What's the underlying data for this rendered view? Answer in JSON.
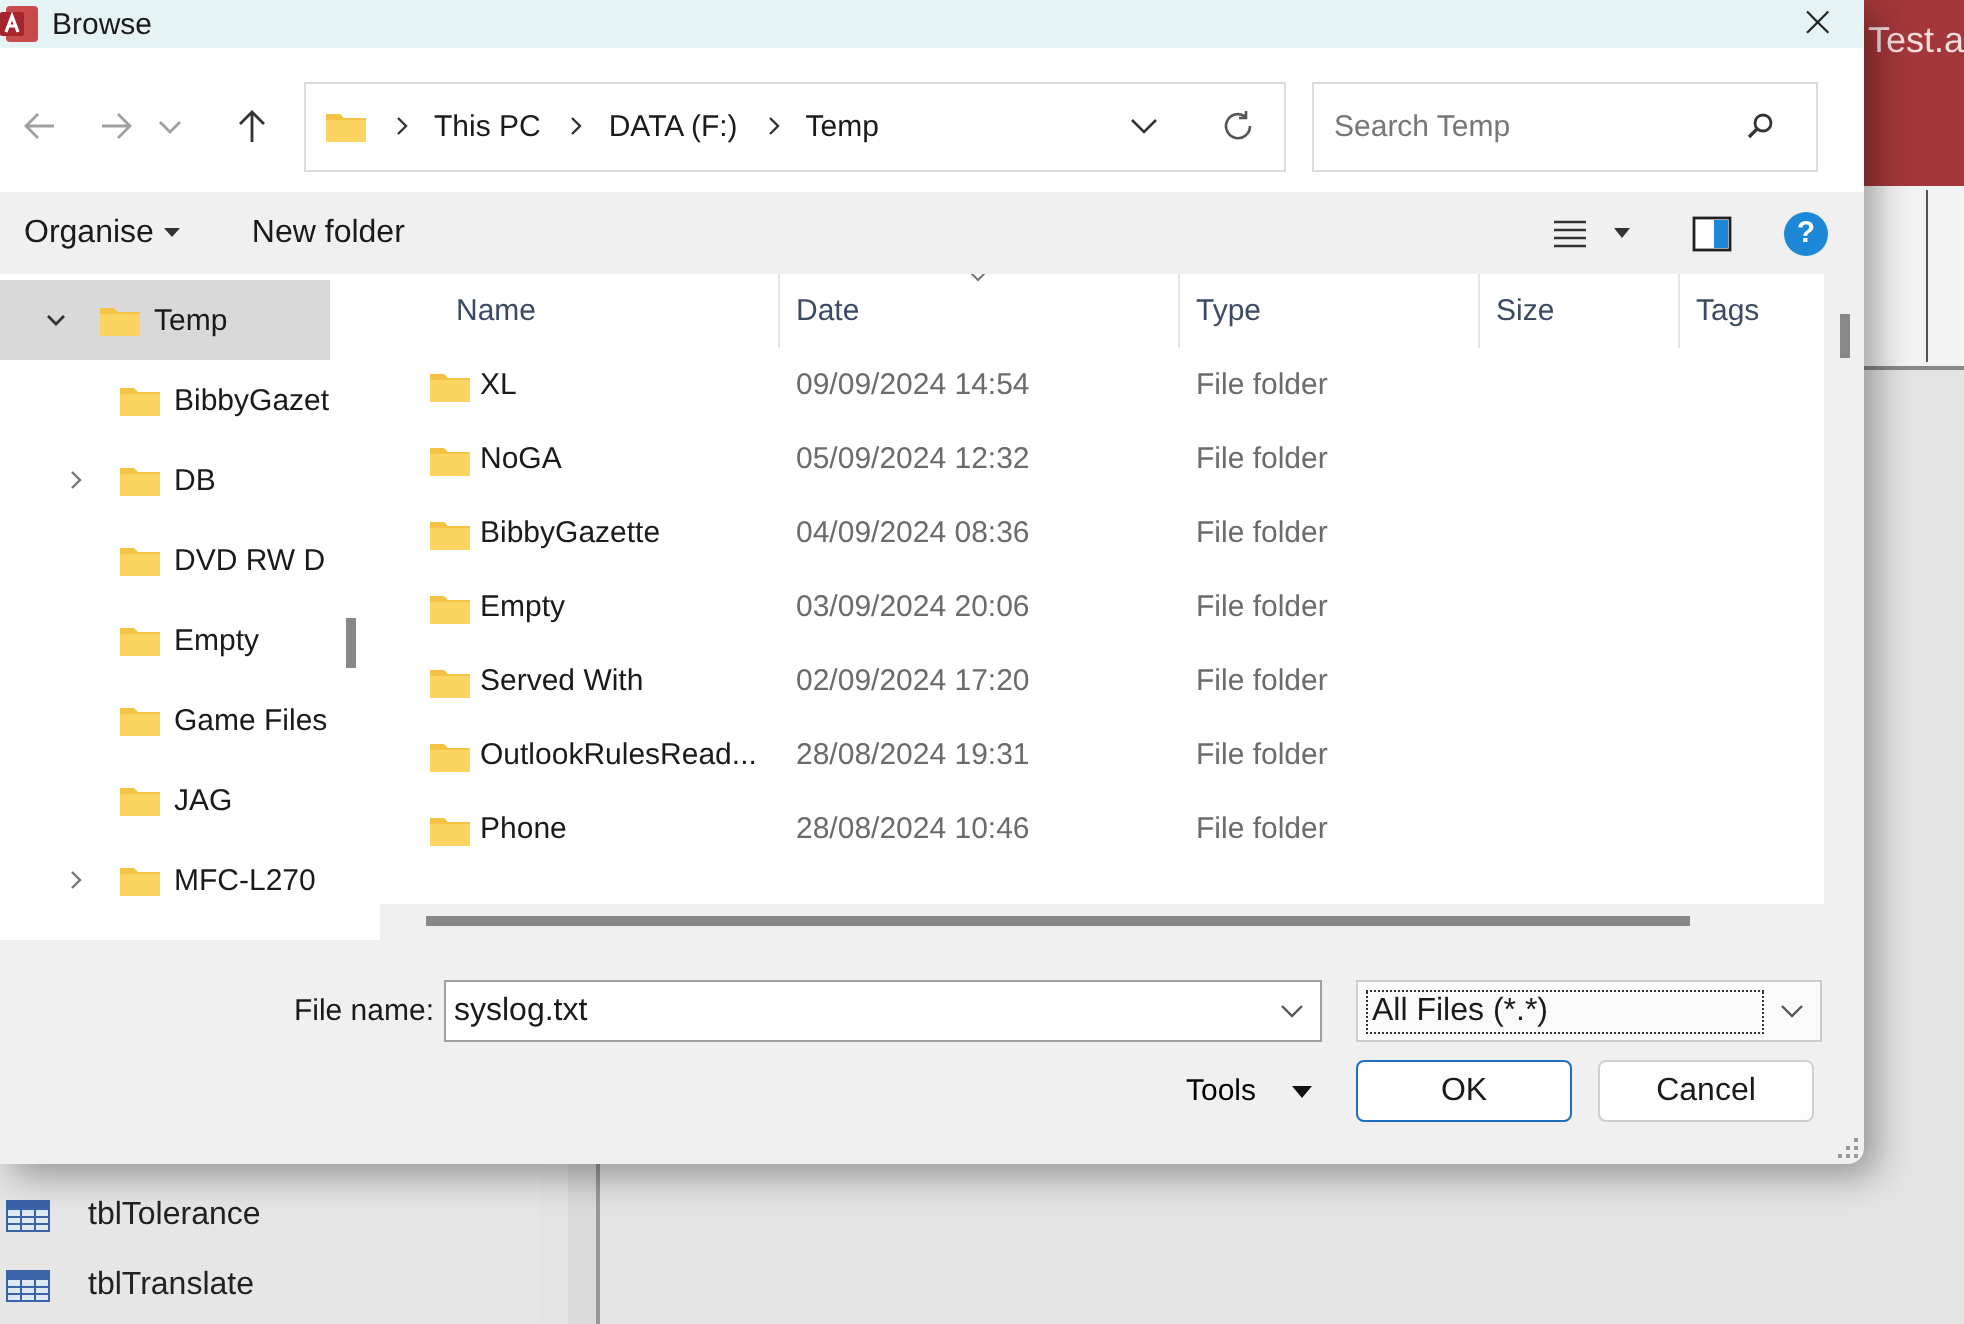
{
  "background_app": {
    "title": "Test.a",
    "tables": [
      {
        "name": "tblTolerance"
      },
      {
        "name": "tblTranslate"
      }
    ]
  },
  "window": {
    "title": "Browse",
    "close": "×"
  },
  "address": {
    "path": [
      {
        "label": "This PC"
      },
      {
        "label": "DATA (F:)"
      },
      {
        "label": "Temp"
      }
    ]
  },
  "search": {
    "placeholder": "Search Temp"
  },
  "toolbar": {
    "organise": "Organise",
    "new_folder": "New folder",
    "help": "?"
  },
  "sidebar": {
    "items": [
      {
        "label": "Temp",
        "selected": true,
        "expandable": true,
        "expanded": true,
        "children": [
          {
            "label": "BibbyGazet",
            "selected": false,
            "expandable": false
          },
          {
            "label": "DB",
            "selected": false,
            "expandable": true,
            "expanded": false
          },
          {
            "label": "DVD RW D",
            "selected": false,
            "expandable": false
          },
          {
            "label": "Empty",
            "selected": false,
            "expandable": false
          },
          {
            "label": "Game Files",
            "selected": false,
            "expandable": false
          },
          {
            "label": "JAG",
            "selected": false,
            "expandable": false
          },
          {
            "label": "MFC-L270",
            "selected": false,
            "expandable": true,
            "expanded": false
          }
        ]
      }
    ]
  },
  "table": {
    "columns": [
      {
        "label": "Name",
        "sorted": false
      },
      {
        "label": "Date",
        "sorted": true
      },
      {
        "label": "Type",
        "sorted": false
      },
      {
        "label": "Size",
        "sorted": false
      },
      {
        "label": "Tags",
        "sorted": false
      }
    ],
    "rows": [
      {
        "name": "XL",
        "date": "09/09/2024 14:54",
        "type": "File folder"
      },
      {
        "name": "NoGA",
        "date": "05/09/2024 12:32",
        "type": "File folder"
      },
      {
        "name": "BibbyGazette",
        "date": "04/09/2024 08:36",
        "type": "File folder"
      },
      {
        "name": "Empty",
        "date": "03/09/2024 20:06",
        "type": "File folder"
      },
      {
        "name": "Served With",
        "date": "02/09/2024 17:20",
        "type": "File folder"
      },
      {
        "name": "OutlookRulesRead...",
        "date": "28/08/2024 19:31",
        "type": "File folder"
      },
      {
        "name": "Phone",
        "date": "28/08/2024 10:46",
        "type": "File folder"
      }
    ]
  },
  "file_name": {
    "label": "File name:",
    "value": "syslog.txt"
  },
  "file_type": {
    "value": "All Files (*.*)"
  },
  "buttons": {
    "tools": "Tools",
    "ok": "OK",
    "cancel": "Cancel"
  }
}
